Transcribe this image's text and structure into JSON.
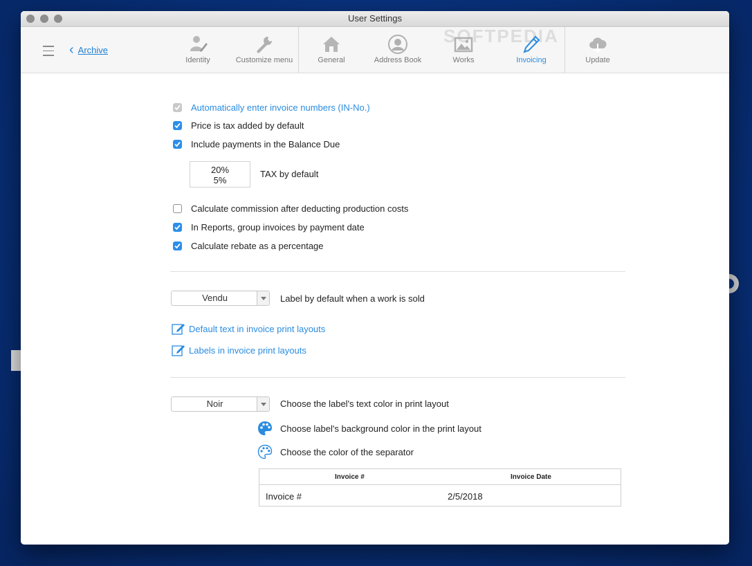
{
  "window": {
    "title": "User Settings"
  },
  "nav": {
    "back_label": "Archive"
  },
  "toolbar": [
    {
      "id": "identity",
      "label": "Identity",
      "icon": "person-pen-icon",
      "active": false
    },
    {
      "id": "customize",
      "label": "Customize menu",
      "icon": "wrench-icon",
      "active": false
    },
    {
      "id": "general",
      "label": "General",
      "icon": "house-icon",
      "active": false
    },
    {
      "id": "addressbook",
      "label": "Address Book",
      "icon": "contact-icon",
      "active": false
    },
    {
      "id": "works",
      "label": "Works",
      "icon": "picture-icon",
      "active": false
    },
    {
      "id": "invoicing",
      "label": "Invoicing",
      "icon": "pencil-icon",
      "active": true
    },
    {
      "id": "update",
      "label": "Update",
      "icon": "cloud-download-icon",
      "active": false
    }
  ],
  "watermark": "SOFTPEDIA",
  "accent_color": "#2a8ce0",
  "options": {
    "auto_invoice_numbers": {
      "label": "Automatically enter invoice numbers (IN-No.)",
      "checked": true,
      "disabled": true
    },
    "price_tax_added": {
      "label": "Price is tax added by default",
      "checked": true
    },
    "include_payments": {
      "label": "Include payments in the Balance Due",
      "checked": true
    },
    "calc_commission": {
      "label": "Calculate commission after deducting production costs",
      "checked": false
    },
    "group_by_payment_date": {
      "label": "In Reports, group invoices by payment date",
      "checked": true
    },
    "rebate_percentage": {
      "label": "Calculate rebate as a percentage",
      "checked": true
    }
  },
  "tax": {
    "values": [
      "20%",
      "5%"
    ],
    "label": "TAX by default"
  },
  "sold_label": {
    "selected": "Vendu",
    "description": "Label by default when a work is sold"
  },
  "links": {
    "default_text": "Default text in invoice print layouts",
    "labels": "Labels in invoice print layouts"
  },
  "text_color": {
    "selected": "Noir",
    "description": "Choose the label's text color in print layout"
  },
  "bg_color_label": "Choose label's background color in the print layout",
  "separator_color_label": "Choose the color of the separator",
  "preview_table": {
    "headers": [
      "Invoice #",
      "Invoice Date"
    ],
    "row": [
      "Invoice #",
      "2/5/2018"
    ]
  }
}
